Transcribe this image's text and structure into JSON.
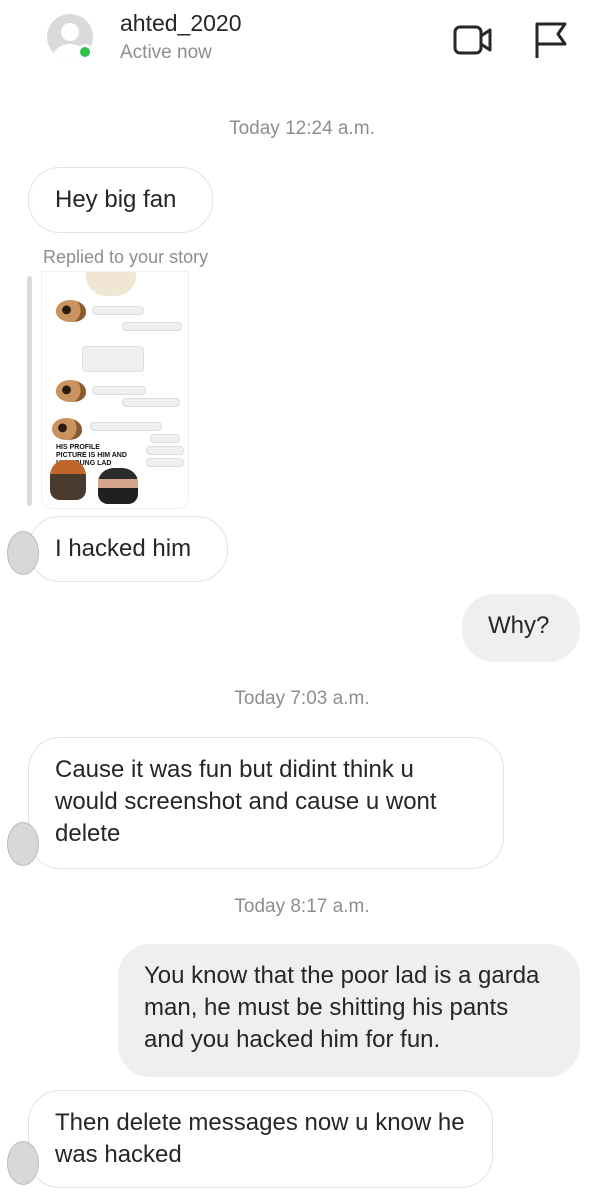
{
  "header": {
    "username": "ahted_2020",
    "status": "Active now",
    "icons": [
      "video-call-icon",
      "report-flag-icon"
    ],
    "online_color": "#2ec24a"
  },
  "timestamps": {
    "t1": "Today 12:24 a.m.",
    "t2": "Today 7:03 a.m.",
    "t3": "Today 8:17 a.m."
  },
  "story_reply": {
    "label": "Replied to your story",
    "caption": "HIS PROFILE PICTURE IS HIM AND HIS YOUNG LAD"
  },
  "messages": [
    {
      "sender": "them",
      "text": "Hey big fan"
    },
    {
      "sender": "them",
      "text": "I hacked him"
    },
    {
      "sender": "me",
      "text": "Why?"
    },
    {
      "sender": "them",
      "text": "Cause it was fun but didint think u would screenshot and cause u wont delete"
    },
    {
      "sender": "me",
      "text": "You know that the poor lad is a garda man, he must be shitting his pants and you hacked him for fun."
    },
    {
      "sender": "them",
      "text": "Then delete messages now u know he was hacked"
    }
  ]
}
